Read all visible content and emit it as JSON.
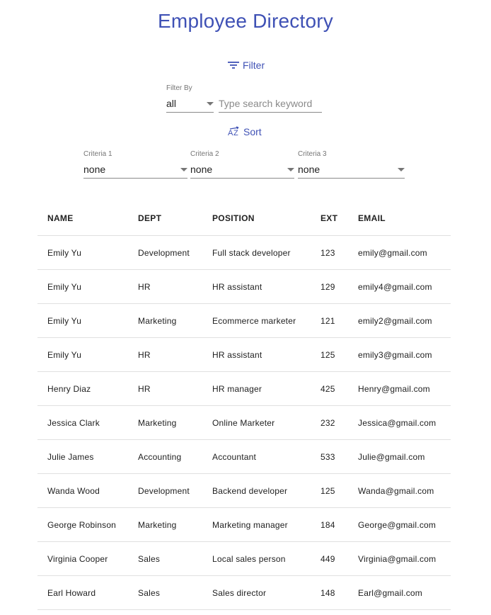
{
  "header": {
    "title": "Employee Directory"
  },
  "filter": {
    "button_label": "Filter",
    "filter_by_label": "Filter By",
    "filter_by_value": "all",
    "search_placeholder": "Type search keyword"
  },
  "sort": {
    "button_label": "Sort",
    "criteria": [
      {
        "label": "Criteria 1",
        "value": "none"
      },
      {
        "label": "Criteria 2",
        "value": "none"
      },
      {
        "label": "Criteria 3",
        "value": "none"
      }
    ]
  },
  "table": {
    "headers": [
      "NAME",
      "DEPT",
      "POSITION",
      "EXT",
      "EMAIL"
    ],
    "rows": [
      [
        "Emily Yu",
        "Development",
        "Full stack developer",
        "123",
        "emily@gmail.com"
      ],
      [
        "Emily Yu",
        "HR",
        "HR assistant",
        "129",
        "emily4@gmail.com"
      ],
      [
        "Emily Yu",
        "Marketing",
        "Ecommerce marketer",
        "121",
        "emily2@gmail.com"
      ],
      [
        "Emily Yu",
        "HR",
        "HR assistant",
        "125",
        "emily3@gmail.com"
      ],
      [
        "Henry Diaz",
        "HR",
        "HR manager",
        "425",
        "Henry@gmail.com"
      ],
      [
        "Jessica Clark",
        "Marketing",
        "Online Marketer",
        "232",
        "Jessica@gmail.com"
      ],
      [
        "Julie James",
        "Accounting",
        "Accountant",
        "533",
        "Julie@gmail.com"
      ],
      [
        "Wanda Wood",
        "Development",
        "Backend developer",
        "125",
        "Wanda@gmail.com"
      ],
      [
        "George Robinson",
        "Marketing",
        "Marketing manager",
        "184",
        "George@gmail.com"
      ],
      [
        "Virginia Cooper",
        "Sales",
        "Local sales person",
        "449",
        "Virginia@gmail.com"
      ],
      [
        "Earl Howard",
        "Sales",
        "Sales director",
        "148",
        "Earl@gmail.com"
      ]
    ]
  },
  "colors": {
    "accent": "#3f51b5",
    "divider": "#e0e0e0"
  },
  "icons": {
    "filter": "filter-list-icon",
    "sort": "sort-by-alpha-icon",
    "caret": "arrow-drop-down-icon"
  }
}
